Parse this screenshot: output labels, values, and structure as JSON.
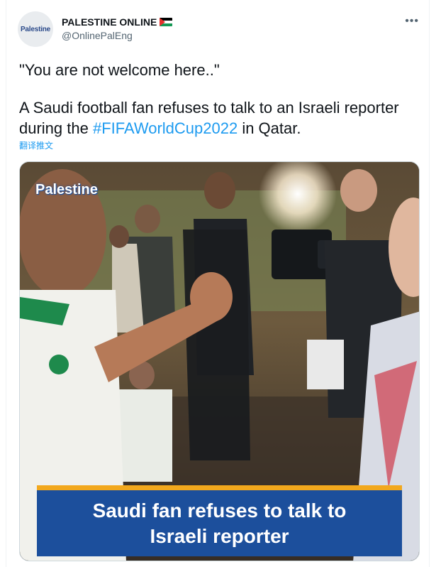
{
  "account": {
    "avatar_text": "Palestine",
    "display_name": "PALESTINE ONLINE",
    "handle": "@OnlinePalEng",
    "flag_icon": "palestine-flag"
  },
  "tweet": {
    "quote": "\"You are not welcome here..\"",
    "line_before_hashtag": "A Saudi football fan refuses to talk to an Israeli reporter during the ",
    "hashtag": "#FIFAWorldCup2022",
    "line_after_hashtag": " in Qatar.",
    "translate_label": "翻译推文"
  },
  "media": {
    "logo_text": "Palestine",
    "caption_line1": "Saudi fan refuses to talk to",
    "caption_line2": "Israeli reporter"
  },
  "colors": {
    "link": "#1d9bf0",
    "caption_bg": "#1c4f9c",
    "caption_accent": "#f2a81d"
  }
}
